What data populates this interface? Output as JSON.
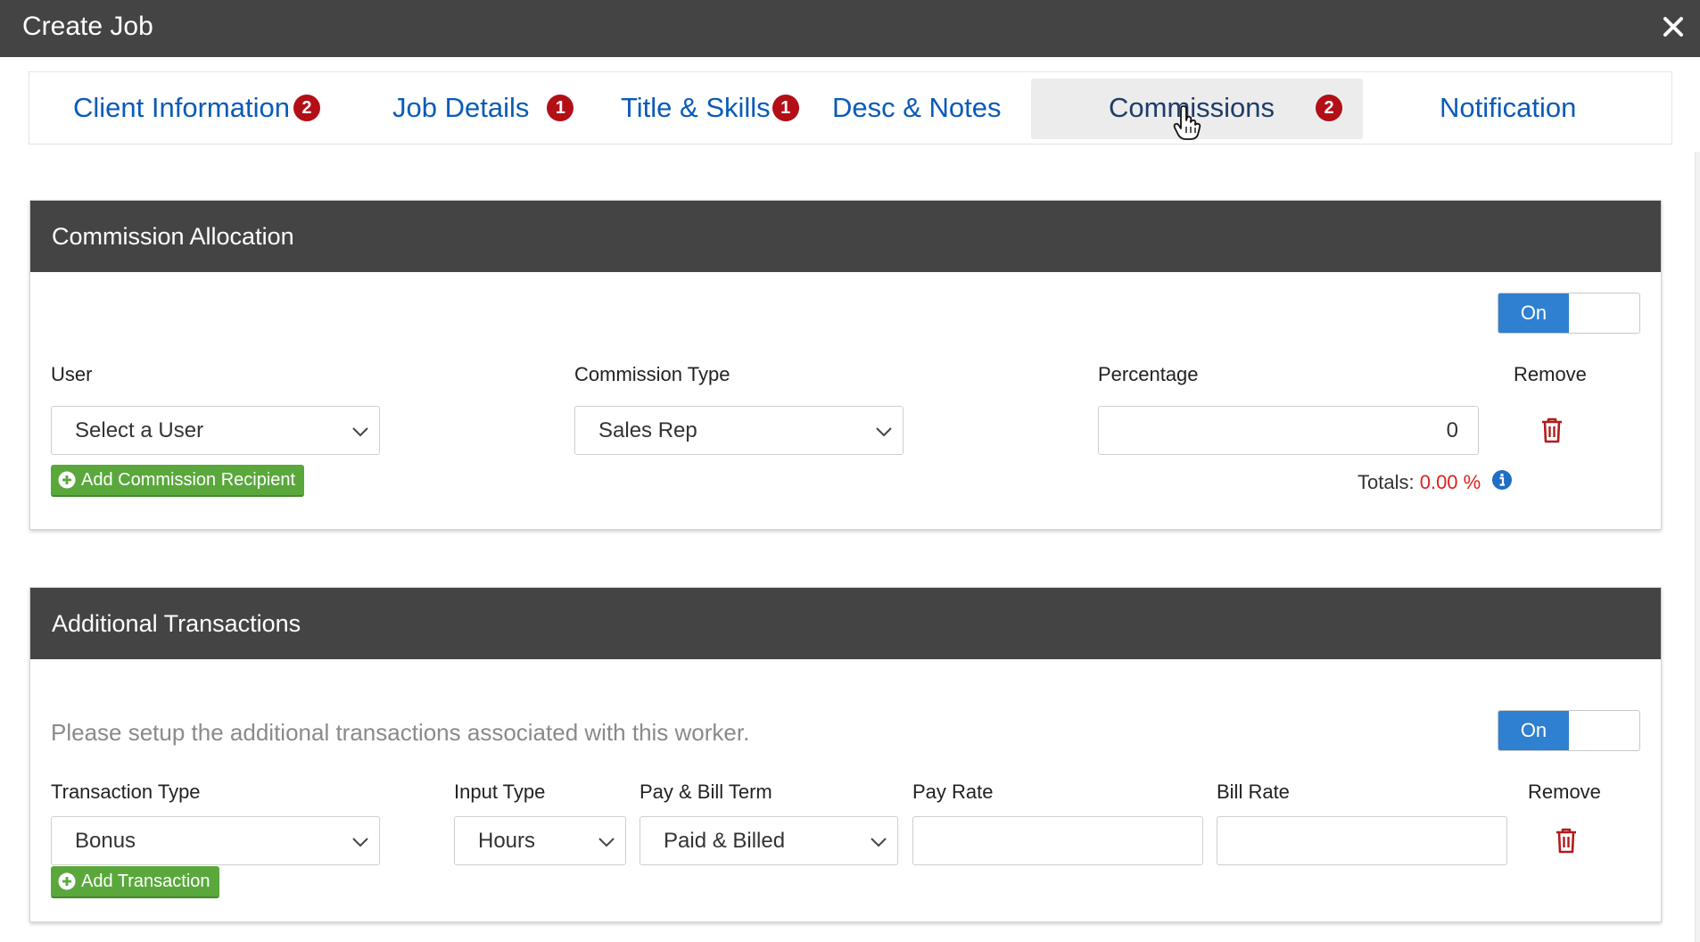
{
  "window": {
    "title": "Create Job"
  },
  "tabs": [
    {
      "label": "Client Information",
      "badge": "2"
    },
    {
      "label": "Job Details",
      "badge": "1"
    },
    {
      "label": "Title & Skills",
      "badge": "1"
    },
    {
      "label": "Desc & Notes",
      "badge": ""
    },
    {
      "label": "Commissions",
      "badge": "2",
      "active": true
    },
    {
      "label": "Notification",
      "badge": ""
    }
  ],
  "commission": {
    "title": "Commission Allocation",
    "toggle_label": "On",
    "user_label": "User",
    "user_value": "Select a User",
    "type_label": "Commission Type",
    "type_value": "Sales Rep",
    "percentage_label": "Percentage",
    "percentage_value": "0",
    "remove_label": "Remove",
    "add_button": "Add Commission Recipient",
    "totals_label": "Totals:",
    "totals_value": "0.00 %"
  },
  "transactions": {
    "title": "Additional Transactions",
    "hint": "Please setup the additional transactions associated with this worker.",
    "toggle_label": "On",
    "transaction_type_label": "Transaction Type",
    "transaction_type_value": "Bonus",
    "input_type_label": "Input Type",
    "input_type_value": "Hours",
    "term_label": "Pay & Bill Term",
    "term_value": "Paid & Billed",
    "pay_rate_label": "Pay Rate",
    "pay_rate_value": "",
    "bill_rate_label": "Bill Rate",
    "bill_rate_value": "",
    "remove_label": "Remove",
    "add_button": "Add Transaction"
  },
  "colors": {
    "header_bg": "#444444",
    "tab_text": "#0a5bb8",
    "badge": "#b20f17",
    "toggle_on": "#2f80d0",
    "add_button": "#5aa83c",
    "trash": "#b01c1c",
    "totals_value": "#e02020",
    "info": "#1f6fc4"
  }
}
